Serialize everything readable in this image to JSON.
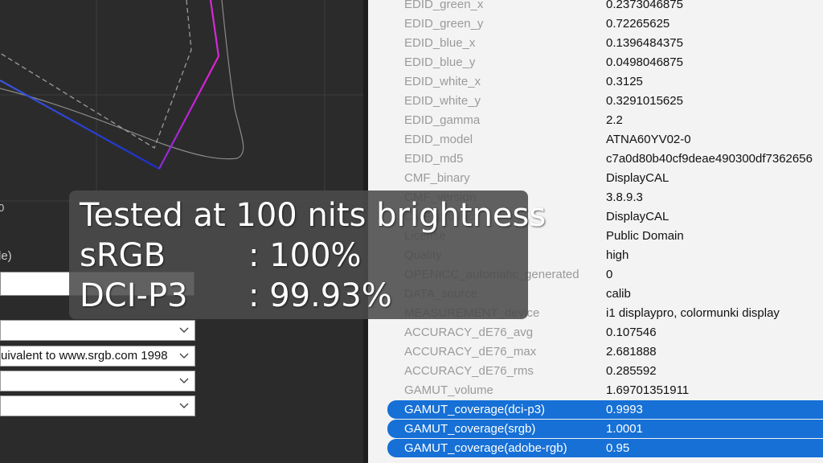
{
  "left_panel": {
    "axis_tick": "0",
    "partial_label": "le)",
    "dropdowns": [
      {
        "value": ""
      },
      {
        "value": "uivalent to www.srgb.com 1998"
      },
      {
        "value": ""
      },
      {
        "value": ""
      }
    ],
    "icons": {
      "dropdown": "chevron-down-icon"
    }
  },
  "overlay": {
    "title": "Tested at 100 nits brightness",
    "lines": [
      {
        "label": "sRGB",
        "value": ": 100%"
      },
      {
        "label": "DCI-P3",
        "value": ": 99.93%"
      }
    ]
  },
  "properties": [
    {
      "key": "EDID_green_x",
      "value": "0.2373046875"
    },
    {
      "key": "EDID_green_y",
      "value": "0.72265625"
    },
    {
      "key": "EDID_blue_x",
      "value": "0.1396484375"
    },
    {
      "key": "EDID_blue_y",
      "value": "0.0498046875"
    },
    {
      "key": "EDID_white_x",
      "value": "0.3125"
    },
    {
      "key": "EDID_white_y",
      "value": "0.3291015625"
    },
    {
      "key": "EDID_gamma",
      "value": "2.2"
    },
    {
      "key": "EDID_model",
      "value": "ATNA60YV02-0"
    },
    {
      "key": "EDID_md5",
      "value": "c7a0d80b40cf9deae490300df7362656"
    },
    {
      "key": "CMF_binary",
      "value": "DisplayCAL"
    },
    {
      "key": "CMF_version",
      "value": "3.8.9.3"
    },
    {
      "key": "CMF_product",
      "value": "DisplayCAL"
    },
    {
      "key": "License",
      "value": "Public Domain"
    },
    {
      "key": "Quality",
      "value": "high"
    },
    {
      "key": "OPENICC_automatic_generated",
      "value": "0"
    },
    {
      "key": "DATA_source",
      "value": "calib"
    },
    {
      "key": "MEASUREMENT_device",
      "value": "i1 displaypro, colormunki display"
    },
    {
      "key": "ACCURACY_dE76_avg",
      "value": "0.107546"
    },
    {
      "key": "ACCURACY_dE76_max",
      "value": "2.681888"
    },
    {
      "key": "ACCURACY_dE76_rms",
      "value": "0.285592"
    },
    {
      "key": "GAMUT_volume",
      "value": "1.69701351911"
    },
    {
      "key": "GAMUT_coverage(dci-p3)",
      "value": "0.9993",
      "selected": true
    },
    {
      "key": "GAMUT_coverage(srgb)",
      "value": "1.0001",
      "selected": true
    },
    {
      "key": "GAMUT_coverage(adobe-rgb)",
      "value": "0.95",
      "selected": true
    }
  ],
  "colors": {
    "selection": "#1670d6",
    "gamut_blue": "#2a3fd9",
    "gamut_magenta": "#c020e0"
  }
}
